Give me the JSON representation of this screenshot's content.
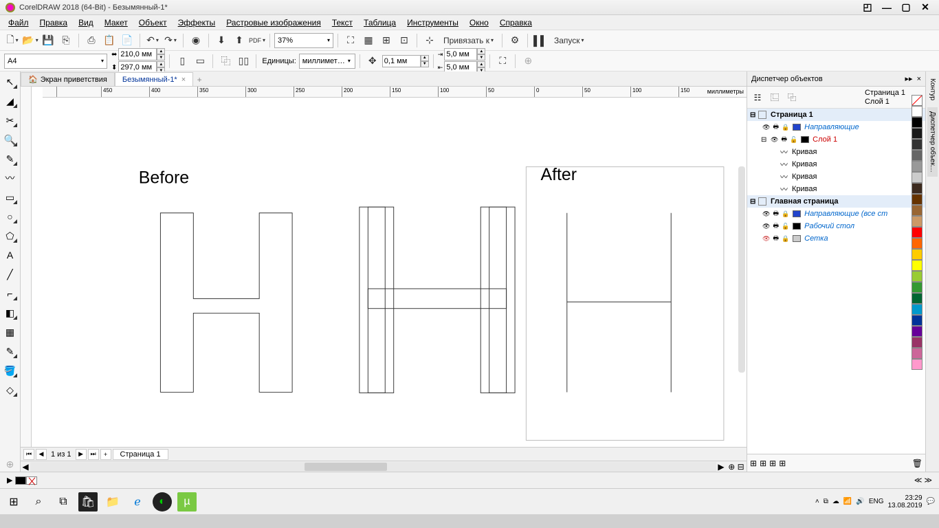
{
  "title": "CorelDRAW 2018 (64-Bit) - Безымянный-1*",
  "menu": [
    "Файл",
    "Правка",
    "Вид",
    "Макет",
    "Объект",
    "Эффекты",
    "Растровые изображения",
    "Текст",
    "Таблица",
    "Инструменты",
    "Окно",
    "Справка"
  ],
  "toolbar1": {
    "zoom": "37%",
    "snap": "Привязать к",
    "launch": "Запуск"
  },
  "propbar": {
    "pagesize": "A4",
    "width": "210,0 мм",
    "height": "297,0 мм",
    "units_label": "Единицы:",
    "units": "миллимет…",
    "nudge": "0,1 мм",
    "dupx": "5,0 мм",
    "dupy": "5,0 мм"
  },
  "doctabs": {
    "welcome": "Экран приветствия",
    "doc": "Безымянный-1*"
  },
  "ruler_unit": "миллиметры",
  "canvas": {
    "before": "Before",
    "after": "After"
  },
  "pagebar": {
    "page_of": "1  из  1",
    "page_tab": "Страница 1"
  },
  "objmgr": {
    "title": "Диспетчер объектов",
    "page": "Страница 1",
    "layer": "Слой 1",
    "guides": "Направляющие",
    "layer1": "Слой 1",
    "curve": "Кривая",
    "masterpage": "Главная страница",
    "allguides": "Направляющие (все ст",
    "desktop": "Рабочий стол",
    "grid": "Сетка"
  },
  "docktabs": [
    "Контур",
    "Диспетчер объек…"
  ],
  "taskbar": {
    "time": "23:29",
    "date": "13.08.2019",
    "lang": "ENG"
  },
  "ruler_ticks": [
    {
      "pos": 20,
      "label": ""
    },
    {
      "pos": 85,
      "label": "450"
    },
    {
      "pos": 155,
      "label": "400"
    },
    {
      "pos": 225,
      "label": "350"
    },
    {
      "pos": 295,
      "label": "300"
    },
    {
      "pos": 365,
      "label": "250"
    },
    {
      "pos": 435,
      "label": "200"
    },
    {
      "pos": 505,
      "label": "150"
    },
    {
      "pos": 575,
      "label": "100"
    },
    {
      "pos": 645,
      "label": "50"
    },
    {
      "pos": 715,
      "label": "0"
    },
    {
      "pos": 785,
      "label": "50"
    },
    {
      "pos": 855,
      "label": "100"
    },
    {
      "pos": 925,
      "label": "150"
    }
  ],
  "colors": [
    "#ffffff",
    "#000000",
    "#1a1a1a",
    "#333333",
    "#666666",
    "#999999",
    "#cccccc",
    "#3d2b1f",
    "#663300",
    "#996633",
    "#cc9966",
    "#ff0000",
    "#ff6600",
    "#ffcc00",
    "#ffff00",
    "#99cc33",
    "#339933",
    "#006633",
    "#0099cc",
    "#003399",
    "#660099",
    "#993366",
    "#cc6699",
    "#ff99cc"
  ]
}
